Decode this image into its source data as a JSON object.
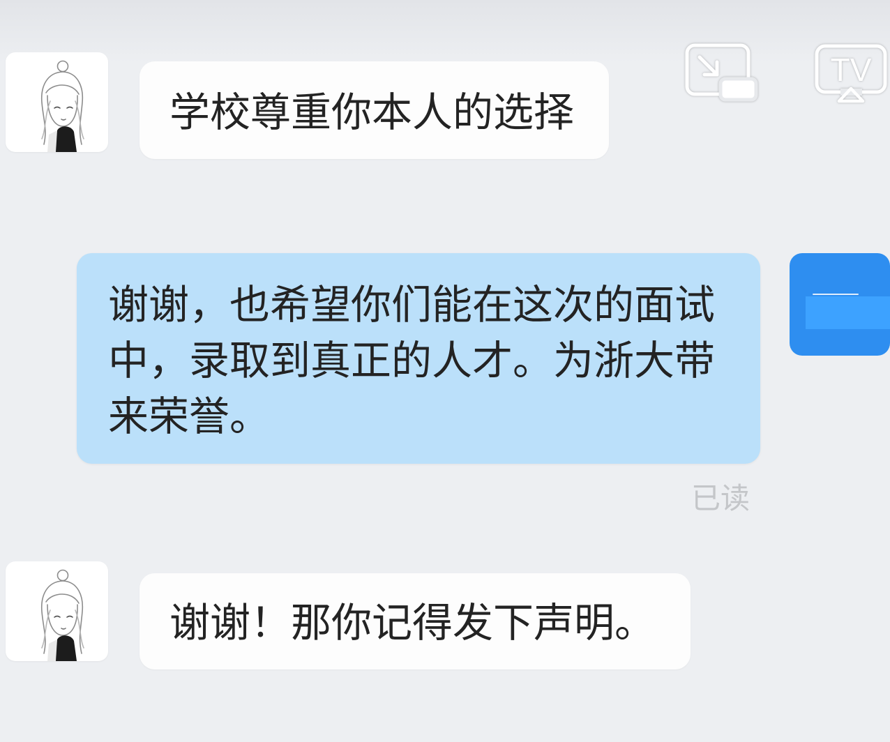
{
  "header": {
    "cast_icon": "screen-cast-icon",
    "tv_icon": "tv-cast-icon",
    "tv_label": "TV"
  },
  "messages": [
    {
      "side": "received",
      "avatar": "sketch-girl-avatar",
      "lines": [
        "学校尊重你本人的选择"
      ]
    },
    {
      "side": "sent",
      "avatar": "blue-logo-avatar",
      "lines": [
        "谢谢，也希望你们能在这次的面试",
        "中，录取到真正的人才。为浙大带",
        "来荣誉。"
      ],
      "status": "已读"
    },
    {
      "side": "received",
      "avatar": "sketch-girl-avatar",
      "lines": [
        "谢谢！那你记得发下声明。"
      ]
    }
  ],
  "colors": {
    "background": "#edeff2",
    "background_top": "#e2e4e8",
    "received_bubble": "#fdfdfd",
    "sent_bubble": "#bbe0fa",
    "text": "#232323",
    "read_status": "#c4c6c9",
    "avatar_blue": "#2e8ef0"
  }
}
